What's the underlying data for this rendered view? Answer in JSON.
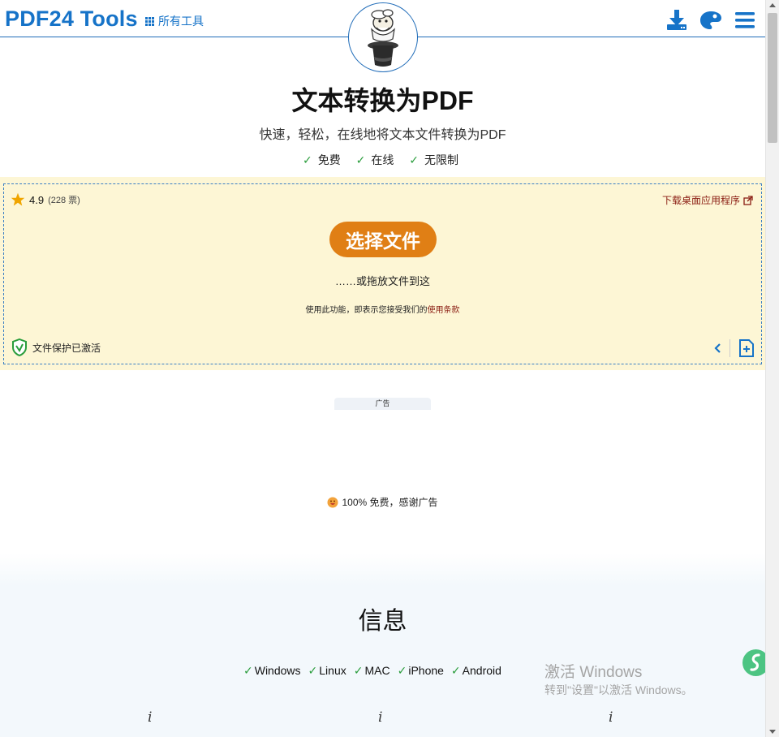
{
  "header": {
    "brand": "PDF24 Tools",
    "all_tools": "所有工具",
    "icons": [
      "download-desktop-icon",
      "palette-icon",
      "menu-icon"
    ]
  },
  "hero": {
    "title": "文本转换为PDF",
    "subtitle": "快速，轻松，在线地将文本文件转换为PDF",
    "features": [
      "免费",
      "在线",
      "无限制"
    ]
  },
  "upload": {
    "rating": "4.9",
    "votes": "(228 票)",
    "desktop_link": "下载桌面应用程序",
    "choose_button": "选择文件",
    "drop_text": "……或拖放文件到这",
    "terms_prefix": "使用此功能，即表示您接受我们的",
    "terms_link": "使用条款",
    "protection": "文件保护已激活"
  },
  "ad": {
    "label": "广告",
    "free_note": "100% 免费，感谢广告"
  },
  "info": {
    "title": "信息",
    "platforms": [
      "Windows",
      "Linux",
      "MAC",
      "iPhone",
      "Android"
    ]
  },
  "watermark": {
    "line1": "激活 Windows",
    "line2": "转到\"设置\"以激活 Windows。"
  },
  "colors": {
    "brand_blue": "#1673c8",
    "button_orange": "#e07f15",
    "panel_bg": "#fdf6d5",
    "link_red": "#8a1c12",
    "check_green": "#2a9d3c"
  }
}
